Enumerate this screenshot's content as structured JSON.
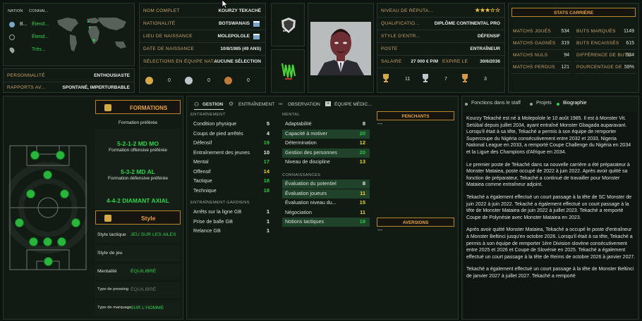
{
  "nation_panel": {
    "col_nation": "NATION",
    "col_connais": "CONNAI...",
    "rows": [
      {
        "nation": "B...",
        "level": "Étend..."
      },
      {
        "nation": "",
        "level": "Étend..."
      },
      {
        "nation": "",
        "level": "Très..."
      }
    ]
  },
  "personality": {
    "label": "PERSONNALITÉ",
    "value": "ENTHOUSIASTE"
  },
  "media": {
    "label": "RAPPORTS AV...",
    "value": "SPONTANÉ, IMPERTURBABLE"
  },
  "identity": [
    {
      "label": "NOM COMPLET",
      "value": "KOURZY TEKACHÉ"
    },
    {
      "label": "NATIONALITÉ",
      "value": "BOTSWANAIS"
    },
    {
      "label": "LIEU DE NAISSANCE",
      "value": "MOLEPOLOLE"
    },
    {
      "label": "DATE DE NAISSANCE",
      "value": "10/8/1985 (49 ANS)"
    },
    {
      "label": "SÉLECTIONS EN ÉQUIPE NAT...",
      "value": "AUCUNE SÉLECTION"
    }
  ],
  "medals": [
    "0",
    "0",
    "0"
  ],
  "club_badge": "BFA",
  "job": [
    {
      "label": "NIVEAU DE RÉPUTA...",
      "value": "★★★☆☆"
    },
    {
      "label": "QUALIFICATIO...",
      "value": "DIPLÔME CONTINENTAL PRO"
    },
    {
      "label": "STYLE D'ENTR...",
      "value": "DÉFENSIF"
    },
    {
      "label": "POSTE",
      "value": "ENTRAÎNEUR"
    }
  ],
  "salary": {
    "label": "SALAIRE",
    "value": "27 000 € P/M",
    "expire_label": "EXPIRE LE",
    "expire": "30/6/2036"
  },
  "trophies": [
    "11",
    "7",
    "3"
  ],
  "career": {
    "title": "STATS CARRIÈRE",
    "left": [
      {
        "label": "MATCHS JOUÉS",
        "value": "534"
      },
      {
        "label": "MATCHS GAGNÉS",
        "value": "319"
      },
      {
        "label": "MATCHS NULS",
        "value": "94"
      },
      {
        "label": "MATCHS PERDUS",
        "value": "121"
      }
    ],
    "right": [
      {
        "label": "BUTS MARQUÉS",
        "value": "1149"
      },
      {
        "label": "BUTS ENCAISSÉS",
        "value": "615"
      },
      {
        "label": "DIFFÉRENCE DE BUTS",
        "value": "534"
      },
      {
        "label": "POURCENTAGE DE ...",
        "value": "59%"
      }
    ]
  },
  "formations": {
    "title": "FORMATIONS",
    "preferred_label": "Formation préférée",
    "offensive": "5-2-1-2 MD MO",
    "offensive_label": "Formation offensive préférée",
    "defensive": "5-3-2 MD AL",
    "defensive_label": "Formation défensive préférée",
    "third": "4-4-2 DIAMANT AXIAL"
  },
  "style": {
    "title": "Style",
    "tactical_label": "Style tactique",
    "tactical": "JEU SUR LES AILES",
    "game_label": "Style de jeu",
    "game": "",
    "mentality_label": "Mentalité",
    "mentality": "ÉQUILIBRÉ",
    "pressing_label": "Type de pressing",
    "pressing": "ÉQUILIBRÉ",
    "marking_label": "Type de marquage",
    "marking": "SUR L'HOMME"
  },
  "tabs": [
    "GESTION",
    "ENTRAÎNEMENT",
    "OBSERVATION",
    "ÉQUIPE MÉDIC..."
  ],
  "attributes": {
    "training_title": "ENTRAÎNEMENT",
    "training": [
      {
        "name": "Condition physique",
        "value": "5",
        "color": "w"
      },
      {
        "name": "Coups de pied arrêtés",
        "value": "4",
        "color": "w"
      },
      {
        "name": "Défensif",
        "value": "19",
        "color": "g"
      },
      {
        "name": "Entraînement des jeunes",
        "value": "10",
        "color": "w"
      },
      {
        "name": "Mental",
        "value": "17",
        "color": "g"
      },
      {
        "name": "Offensif",
        "value": "14",
        "color": "y"
      },
      {
        "name": "Tactique",
        "value": "18",
        "color": "g"
      },
      {
        "name": "Technique",
        "value": "18",
        "color": "g"
      }
    ],
    "gk_title": "ENTRAÎNEMENT GARDIENS",
    "gk": [
      {
        "name": "Arrêts sur la ligne GB",
        "value": "1",
        "color": "w"
      },
      {
        "name": "Prise de balle GB",
        "value": "1",
        "color": "w"
      },
      {
        "name": "Relance GB",
        "value": "1",
        "color": "w"
      }
    ],
    "mental_title": "MENTAL",
    "mental": [
      {
        "name": "Adaptabilité",
        "value": "8",
        "color": "w"
      },
      {
        "name": "Capacité à motiver",
        "value": "20",
        "color": "g"
      },
      {
        "name": "Détermination",
        "value": "12",
        "color": "y"
      },
      {
        "name": "Gestion des personnes",
        "value": "20",
        "color": "g"
      },
      {
        "name": "Niveau de discipline",
        "value": "13",
        "color": "y"
      }
    ],
    "knowledge_title": "CONNAISSANCES",
    "knowledge": [
      {
        "name": "Évaluation du potentiel",
        "value": "8",
        "color": "w"
      },
      {
        "name": "Évaluation joueurs",
        "value": "11",
        "color": "y"
      },
      {
        "name": "Évaluation niveau du...",
        "value": "15",
        "color": "y"
      },
      {
        "name": "Négociation",
        "value": "11",
        "color": "y"
      },
      {
        "name": "Notions tactiques",
        "value": "18",
        "color": "g"
      }
    ]
  },
  "penchants": {
    "title": "PENCHANTS",
    "value": "---"
  },
  "aversions": {
    "title": "AVERSIONS",
    "value": "---"
  },
  "right_tabs": [
    "Fonctions dans le staff",
    "Projets",
    "Biographie"
  ],
  "bio": [
    "Kourzy Tekaché est né à Molepolole le 10 août 1985. Il est à Monster Vit. Setúbal depuis juillet 2034, ayant entraîné Monster Gbagada auparavant. Lorsqu'il était à sa tête, Tekaché a permis à son équipe de remporter Supercoupe du Nigéria consécutivement entre 2032 et 2033, Nigeria National League en 2033, a remporté Coupe Challenge du Nigéria en 2034 et la Ligue des Champions d'Afrique en 2034.",
    "Le premier poste de Tekaché dans sa nouvelle carrière a été préparateur à Monster Mataiea, poste occupé de 2022 à juin 2022. Après avoir quitté sa fonction de préparateur, Tekaché a continué de travailler pour Monster Mataiea comme entraîneur adjoint.",
    "Tekaché a également effectué un court passage à la tête de SC Monster de juin 2022 à juin 2022. Tekaché a également effectué un court passage à la tête de Monster Mataiea de juin 2022 à juillet 2023. Tekaché a remporté Coupe de Polynésie avec Monster Mataiea en 2023.",
    "Après avoir quitté Monster Mataiea, Tekaché a occupé le poste d'entraîneur à Monster Beltinci jusqu'en octobre 2026. Lorsqu'il était à sa tête, Tekaché a permis à son équipe de remporter 1ère Division slovène consécutivement entre 2025 et 2026 et Coupe de Slovénie en 2025. Tekaché a également effectué un court passage à la tête de Reims de octobre 2026 à janvier 2027.",
    "Tekaché a également effectué un court passage à la tête de Monster Beltinci de janvier 2027 à juillet 2027. Tekaché a remporté"
  ],
  "colors": {
    "accent": "#b8862a",
    "green": "#27c93f",
    "yellow": "#e8d31c",
    "panel": "#121a14"
  }
}
